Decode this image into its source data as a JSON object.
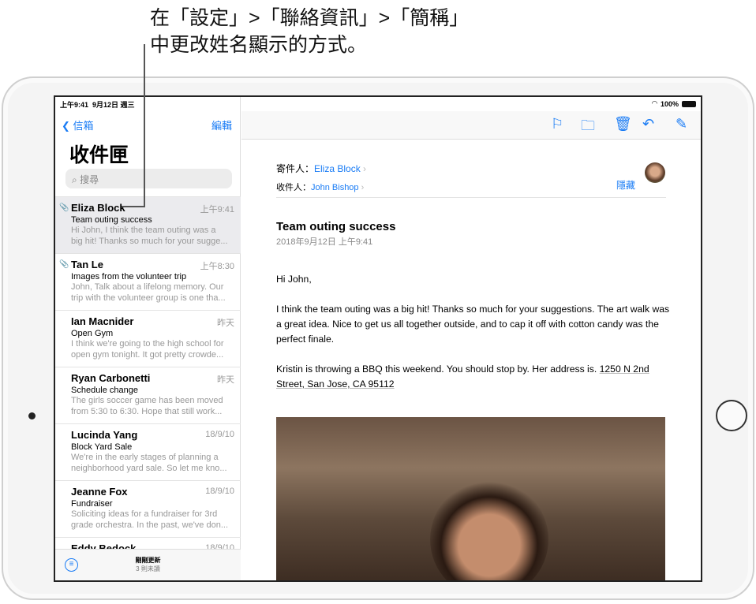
{
  "callout": {
    "line1": "在「設定」>「聯絡資訊」>「簡稱」",
    "line2": "中更改姓名顯示的方式。"
  },
  "status": {
    "time": "上午9:41",
    "date": "9月12日 週三",
    "battery": "100%"
  },
  "sidebar": {
    "back": "信箱",
    "edit": "編輯",
    "title": "收件匣",
    "search_placeholder": "搜尋",
    "items": [
      {
        "from": "Eliza Block",
        "date": "上午9:41",
        "subject": "Team outing success",
        "preview1": "Hi John, I think the team outing was a",
        "preview2": "big hit! Thanks so much for your sugge...",
        "attachment": true
      },
      {
        "from": "Tan Le",
        "date": "上午8:30",
        "subject": "Images from the volunteer trip",
        "preview1": "John, Talk about a lifelong memory. Our",
        "preview2": "trip with the volunteer group is one tha...",
        "attachment": true
      },
      {
        "from": "Ian Macnider",
        "date": "昨天",
        "subject": "Open Gym",
        "preview1": "I think we're going to the high school for",
        "preview2": "open gym tonight. It got pretty crowde..."
      },
      {
        "from": "Ryan Carbonetti",
        "date": "昨天",
        "subject": "Schedule change",
        "preview1": "The girls soccer game has been moved",
        "preview2": "from 5:30 to 6:30. Hope that still work..."
      },
      {
        "from": "Lucinda Yang",
        "date": "18/9/10",
        "subject": "Block Yard Sale",
        "preview1": "We're in the early stages of planning a",
        "preview2": "neighborhood yard sale. So let me kno..."
      },
      {
        "from": "Jeanne Fox",
        "date": "18/9/10",
        "subject": "Fundraiser",
        "preview1": "Soliciting ideas for a fundraiser for 3rd",
        "preview2": "grade orchestra. In the past, we've don..."
      },
      {
        "from": "Eddy Bedock",
        "date": "18/9/10",
        "subject": "",
        "preview1": "",
        "preview2": ""
      }
    ],
    "updated": "剛剛更新",
    "unread": "3 則未讀"
  },
  "message": {
    "from_label": "寄件人：",
    "from": "Eliza Block",
    "to_label": "收件人：",
    "to": "John Bishop",
    "hide": "隱藏",
    "subject": "Team outing success",
    "date": "2018年9月12日 上午9:41",
    "greeting": "Hi John,",
    "para1": "I think the team outing was a big hit! Thanks so much for your suggestions. The art walk was a great idea. Nice to get us all together outside, and to cap it off with cotton candy was the perfect finale.",
    "para2": "Kristin is throwing a BBQ this weekend. You should stop by. Her address is. ",
    "address": "1250 N 2nd Street, San Jose, CA 95112"
  },
  "colors": {
    "accent": "#1a7cf5"
  }
}
